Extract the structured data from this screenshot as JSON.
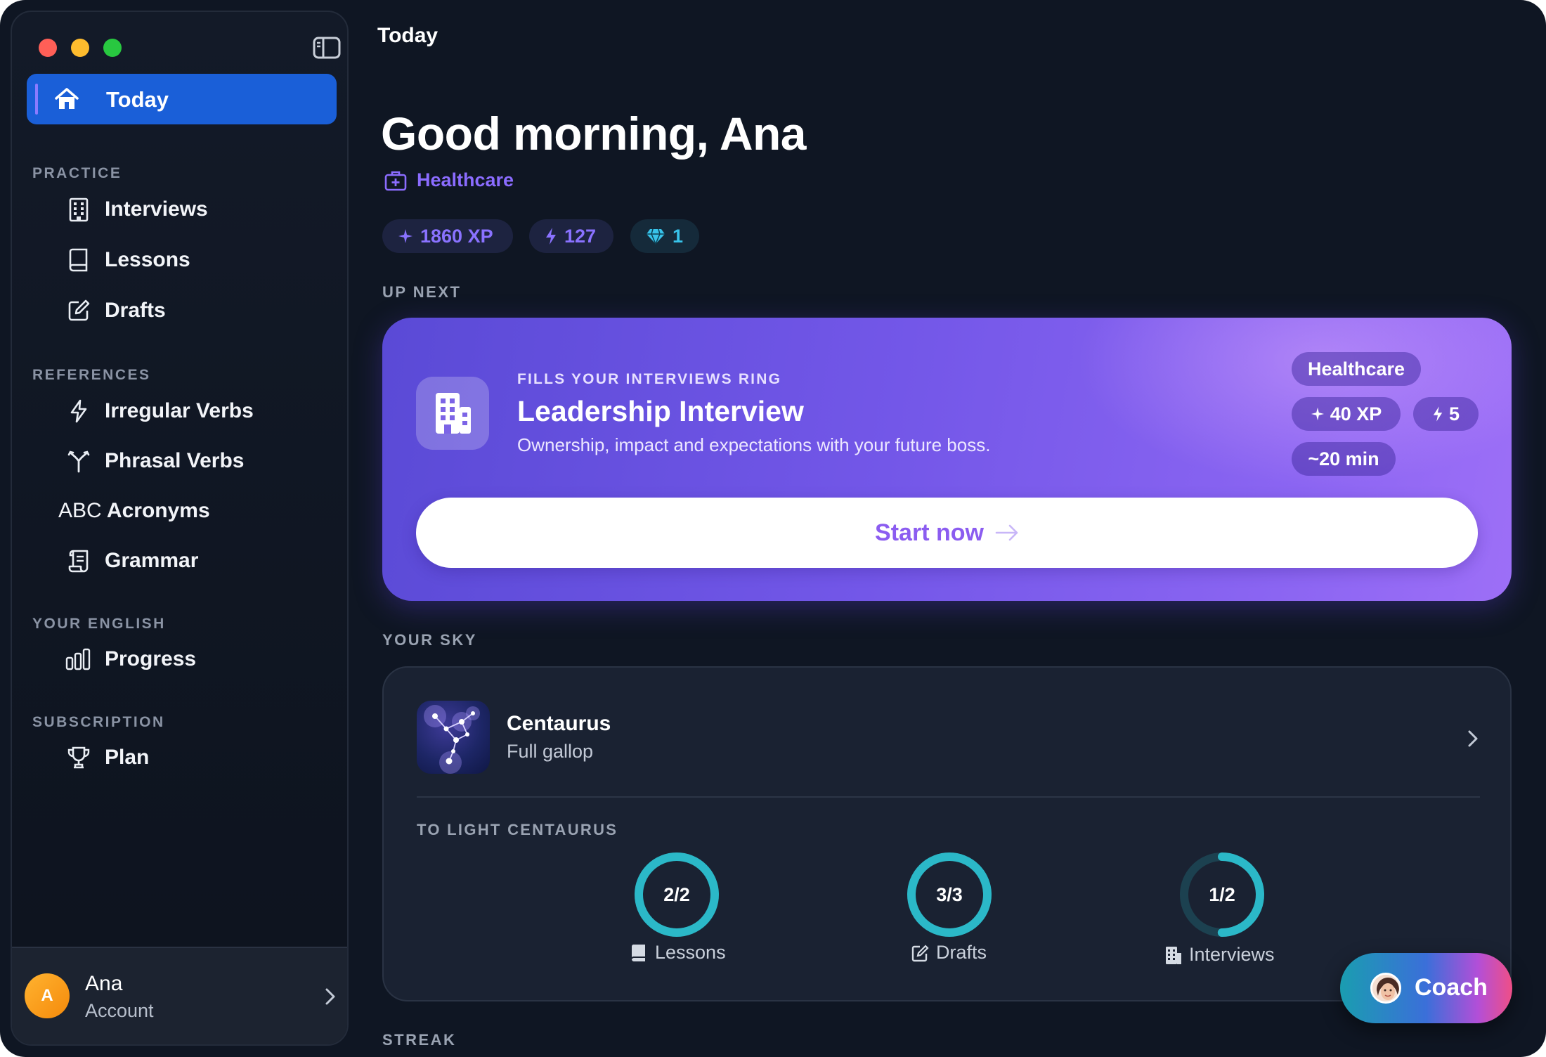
{
  "window": {
    "title": "Today"
  },
  "sidebar": {
    "today": {
      "label": "Today"
    },
    "sections": [
      {
        "title": "PRACTICE",
        "items": [
          {
            "label": "Interviews",
            "icon": "building-icon"
          },
          {
            "label": "Lessons",
            "icon": "book-icon"
          },
          {
            "label": "Drafts",
            "icon": "edit-icon"
          }
        ]
      },
      {
        "title": "REFERENCES",
        "items": [
          {
            "label": "Irregular Verbs",
            "icon": "bolt-icon"
          },
          {
            "label": "Phrasal Verbs",
            "icon": "fork-icon"
          },
          {
            "label": "Acronyms",
            "prefix": "ABC"
          },
          {
            "label": "Grammar",
            "icon": "scroll-icon"
          }
        ]
      },
      {
        "title": "YOUR ENGLISH",
        "items": [
          {
            "label": "Progress",
            "icon": "bar-chart-icon"
          }
        ]
      },
      {
        "title": "SUBSCRIPTION",
        "items": [
          {
            "label": "Plan",
            "icon": "trophy-icon"
          }
        ]
      }
    ],
    "account": {
      "initial": "A",
      "name": "Ana",
      "subtitle": "Account"
    }
  },
  "main": {
    "greeting": "Good morning, Ana",
    "industry": "Healthcare",
    "stats": {
      "xp": "1860 XP",
      "streak": "127",
      "gems": "1"
    },
    "up_next": {
      "section_label": "UP NEXT",
      "kicker": "FILLS YOUR INTERVIEWS RING",
      "title": "Leadership Interview",
      "description": "Ownership, impact and expectations with your future boss.",
      "tags": {
        "industry": "Healthcare",
        "xp": "40 XP",
        "energy": "5",
        "time": "~20 min"
      },
      "cta": "Start now"
    },
    "sky": {
      "section_label": "YOUR SKY",
      "constellation": "Centaurus",
      "status": "Full gallop",
      "light_label": "TO LIGHT CENTAURUS",
      "rings": [
        {
          "value": "2/2",
          "label": "Lessons",
          "progress": 1.0
        },
        {
          "value": "3/3",
          "label": "Drafts",
          "progress": 1.0
        },
        {
          "value": "1/2",
          "label": "Interviews",
          "progress": 0.5
        }
      ]
    },
    "streak_label": "STREAK",
    "coach": {
      "label": "Coach"
    }
  },
  "colors": {
    "accent_blue": "#1a5fd8",
    "purple": "#8a72ff",
    "teal": "#2bb8c8",
    "gem": "#38c3ea"
  }
}
